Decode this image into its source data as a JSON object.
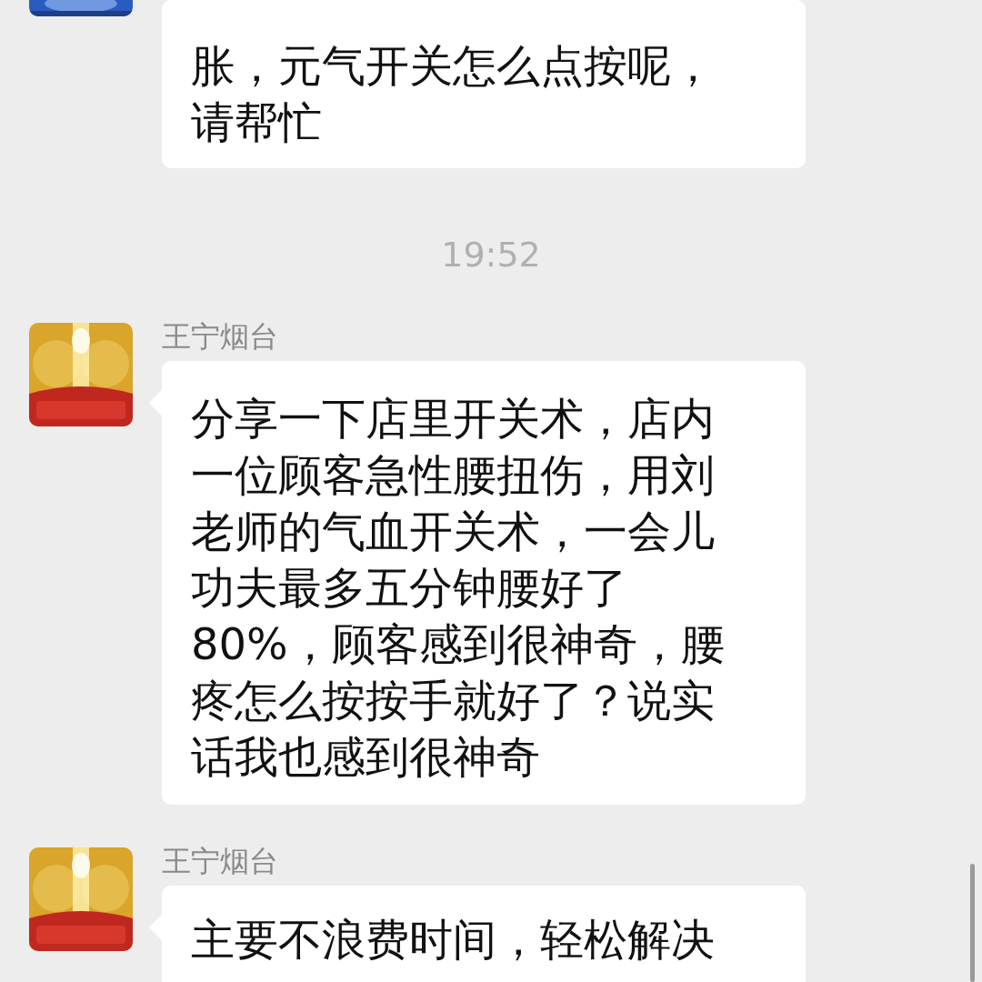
{
  "messages": [
    {
      "kind": "message",
      "cut_top": true,
      "color": "#2a5bbf",
      "text": "胀，元气开关怎么点按呢，请帮忙"
    },
    {
      "kind": "time",
      "text": "19:52"
    },
    {
      "kind": "message",
      "cut_top": false,
      "color": "#d9a52a",
      "sender": "王宁烟台",
      "text": "分享一下店里开关术，店内一位顾客急性腰扭伤，用刘老师的气血开关术，一会儿功夫最多五分钟腰好了80%，顾客感到很神奇，腰疼怎么按按手就好了？说实话我也感到很神奇"
    },
    {
      "kind": "message",
      "cut_top": false,
      "color": "#d9a52a",
      "sender": "王宁烟台",
      "text": "主要不浪费时间，轻松解决"
    }
  ]
}
